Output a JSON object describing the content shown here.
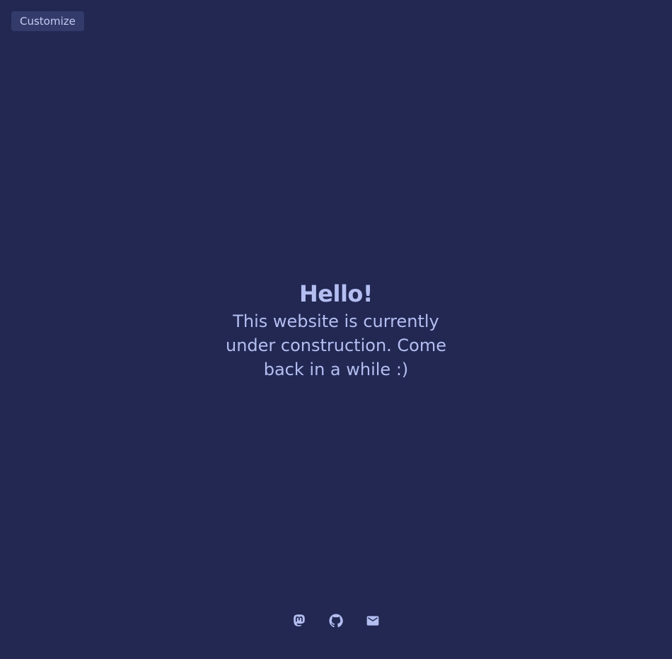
{
  "toolbar": {
    "customize_label": "Customize"
  },
  "hero": {
    "title": "Hello!",
    "message": "This website is currently under construction. Come back in a while :)"
  },
  "socials": [
    {
      "icon": "mastodon-icon"
    },
    {
      "icon": "github-icon"
    },
    {
      "icon": "mail-icon"
    }
  ],
  "colors": {
    "background": "#222852",
    "accent": "#b4bef1",
    "button_bg": "#333b6b"
  }
}
